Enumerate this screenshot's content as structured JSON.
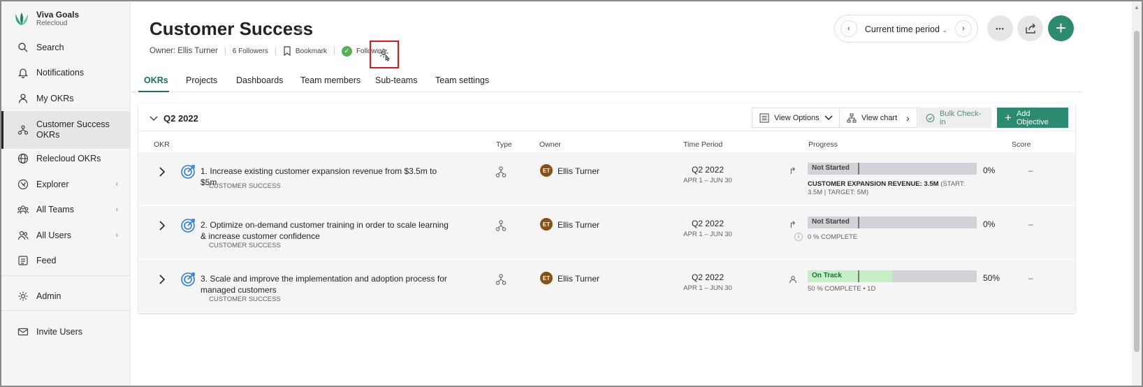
{
  "brand": {
    "name": "Viva Goals",
    "org": "Relecloud"
  },
  "sidebar": {
    "items": [
      {
        "label": "Search",
        "icon": "search-icon"
      },
      {
        "label": "Notifications",
        "icon": "bell-icon"
      },
      {
        "label": "My OKRs",
        "icon": "person-icon"
      },
      {
        "label": "Customer Success OKRs",
        "label_line1": "Customer Success",
        "label_line2": "OKRs",
        "icon": "team-icon",
        "active": true
      },
      {
        "label": "Relecloud OKRs",
        "icon": "globe-icon"
      },
      {
        "label": "Explorer",
        "icon": "compass-icon",
        "has_chevron": true
      },
      {
        "label": "All Teams",
        "icon": "teams-icon",
        "has_chevron": true
      },
      {
        "label": "All Users",
        "icon": "users-icon",
        "has_chevron": true
      },
      {
        "label": "Feed",
        "icon": "feed-icon"
      },
      {
        "label": "Admin",
        "icon": "gear-icon"
      },
      {
        "label": "Invite Users",
        "icon": "mail-icon"
      }
    ]
  },
  "header": {
    "title": "Customer Success",
    "owner": "Owner: Ellis Turner",
    "followers": "6 Followers",
    "bookmark": "Bookmark",
    "following": "Following",
    "time_period": "Current time period",
    "more_label": "•••"
  },
  "tabs": [
    {
      "label": "OKRs",
      "active": true
    },
    {
      "label": "Projects"
    },
    {
      "label": "Dashboards"
    },
    {
      "label": "Team members"
    },
    {
      "label": "Sub-teams"
    },
    {
      "label": "Team settings"
    }
  ],
  "section": {
    "title": "Q2 2022",
    "view_options": "View Options",
    "view_chart": "View chart",
    "bulk_checkin": "Bulk Check-in",
    "add_objective": "Add Objective"
  },
  "columns": {
    "okr": "OKR",
    "type": "Type",
    "owner": "Owner",
    "time_period": "Time Period",
    "progress": "Progress",
    "score": "Score"
  },
  "okrs": [
    {
      "number": "1.",
      "title": "Increase existing customer expansion revenue from $3.5m to $5m",
      "team": "CUSTOMER SUCCESS",
      "owner_initials": "ET",
      "owner": "Ellis Turner",
      "period": "Q2 2022",
      "period_range": "APR 1 – JUN 30",
      "status": "Not Started",
      "progress": 0,
      "progress_label": "0%",
      "detail_bold": "CUSTOMER EXPANSION REVENUE: 3.5M",
      "detail_rest": " (START: 3.5M | TARGET: 5M)",
      "score": "–"
    },
    {
      "number": "2.",
      "title": "Optimize on-demand customer training in order to scale learning & increase customer confidence",
      "team": "CUSTOMER SUCCESS",
      "owner_initials": "ET",
      "owner": "Ellis Turner",
      "period": "Q2 2022",
      "period_range": "APR 1 – JUN 30",
      "status": "Not Started",
      "progress": 0,
      "progress_label": "0%",
      "detail": "0 % COMPLETE",
      "info_label": "i",
      "score": "–"
    },
    {
      "number": "3.",
      "title": "Scale and improve the implementation and adoption process for managed customers",
      "team": "CUSTOMER SUCCESS",
      "owner_initials": "ET",
      "owner": "Ellis Turner",
      "period": "Q2 2022",
      "period_range": "APR 1 – JUN 30",
      "status": "On Track",
      "progress": 50,
      "progress_label": "50%",
      "detail": "50 % COMPLETE • 1D",
      "score": "–"
    }
  ],
  "colors": {
    "accent": "#2c8a70",
    "not_started_bar": "#d2d3d8",
    "on_track_fill": "#c6efc6",
    "highlight_box": "#e0161b"
  }
}
